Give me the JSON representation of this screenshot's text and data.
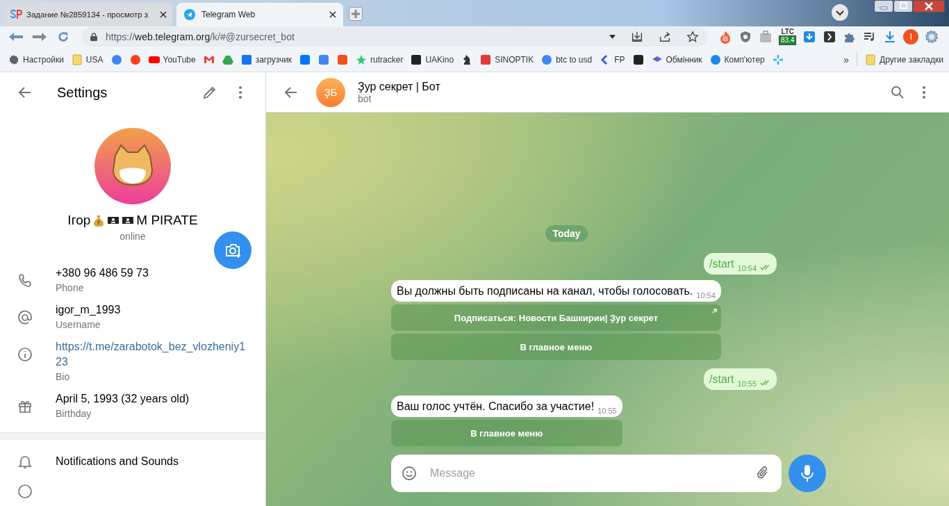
{
  "browser": {
    "tabs": [
      {
        "title": "Задание №2859134 - просмотр з",
        "selected": false
      },
      {
        "title": "Telegram Web",
        "selected": true
      }
    ],
    "url": {
      "scheme": "https://",
      "host": "web.telegram.org",
      "path": "/k/#@zursecret_bot"
    },
    "extension_label": "LTC",
    "extension_badge": "83.4",
    "profile_initial": "I",
    "bookmarks": [
      {
        "kind": "link",
        "label": "Настройки"
      },
      {
        "kind": "link",
        "label": "USA"
      },
      {
        "kind": "icon"
      },
      {
        "kind": "icon"
      },
      {
        "kind": "link",
        "label": "YouTube"
      },
      {
        "kind": "icon"
      },
      {
        "kind": "icon"
      },
      {
        "kind": "link",
        "label": "загрузчик"
      },
      {
        "kind": "icon"
      },
      {
        "kind": "icon"
      },
      {
        "kind": "icon"
      },
      {
        "kind": "link",
        "label": "rutracker"
      },
      {
        "kind": "link",
        "label": "UAKino"
      },
      {
        "kind": "icon"
      },
      {
        "kind": "link",
        "label": "SINOPTIK"
      },
      {
        "kind": "link",
        "label": "btc to usd"
      },
      {
        "kind": "link",
        "label": "FP"
      },
      {
        "kind": "icon"
      },
      {
        "kind": "link",
        "label": "Обмінник"
      },
      {
        "kind": "link",
        "label": "Комп'ютер"
      },
      {
        "kind": "icon"
      }
    ],
    "overflow": "»",
    "other_bookmarks": "Другие закладки"
  },
  "settings": {
    "title": "Settings",
    "name": "Ігор",
    "name_suffix": "M PIRATE",
    "status": "online",
    "rows": [
      {
        "kind": "phone",
        "value": "+380 96 486 59 73",
        "label": "Phone"
      },
      {
        "kind": "username",
        "value": "igor_m_1993",
        "label": "Username"
      },
      {
        "kind": "bio",
        "value": "https://t.me/zarabotok_bez_vlozheniy123",
        "label": "Bio"
      },
      {
        "kind": "birthday",
        "value": "April 5, 1993 (32 years old)",
        "label": "Birthday"
      }
    ],
    "menu": [
      {
        "kind": "bell",
        "label": "Notifications and Sounds"
      }
    ]
  },
  "chat": {
    "title": "Ҙур секрет | Бот",
    "avatar": "ҘБ",
    "subtitle": "bot",
    "date": "Today",
    "messages": [
      {
        "kind": "out",
        "text": "/start",
        "time": "10:54",
        "read": true
      },
      {
        "kind": "in",
        "text": "Вы должны быть подписаны на канал, чтобы голосовать.",
        "time": "10:54",
        "buttons": [
          {
            "kind": "url",
            "label": "Подписаться: Новости Башкирии| Ҙур секрет"
          },
          {
            "kind": "callback",
            "label": "В главное меню"
          }
        ]
      },
      {
        "kind": "out",
        "text": "/start",
        "time": "10:55",
        "read": true
      },
      {
        "kind": "in",
        "text": "Ваш голос учтён. Спасибо за участие!",
        "time": "10:55",
        "buttons": [
          {
            "kind": "callback",
            "label": "В главное меню"
          }
        ]
      }
    ],
    "composer": {
      "placeholder": "Message"
    }
  }
}
